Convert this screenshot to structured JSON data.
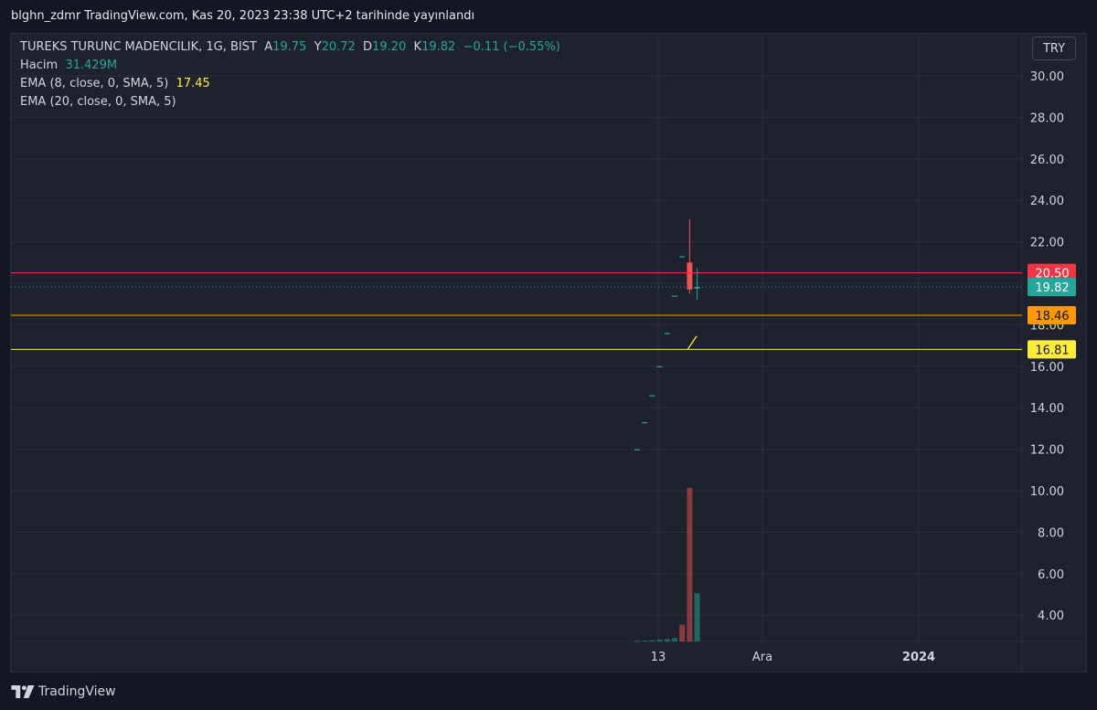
{
  "header": {
    "publish_text": "blghn_zdmr TradingView.com, Kas 20, 2023 23:38 UTC+2 tarihinde yayınlandı"
  },
  "legend": {
    "symbol": "TUREKS TURUNC MADENCILIK, 1G, BIST",
    "o_label": "A",
    "o_value": "19.75",
    "h_label": "Y",
    "h_value": "20.72",
    "l_label": "D",
    "l_value": "19.20",
    "c_label": "K",
    "c_value": "19.82",
    "change": "−0.11 (−0.55%)",
    "volume_label": "Hacim",
    "volume_value": "31.429M",
    "ema8_label": "EMA (8, close, 0, SMA, 5)",
    "ema8_value": "17.45",
    "ema20_label": "EMA (20, close, 0, SMA, 5)"
  },
  "currency_button": "TRY",
  "colors": {
    "up": "#26a69a",
    "down": "#ef5350",
    "resistance": "#f23645",
    "ema20": "#ff9800",
    "ema8": "#ffeb3b",
    "grid": "#2a2e39",
    "background": "#1e222d"
  },
  "footer": {
    "logo_icon": "tradingview-logo-icon",
    "brand": "TradingView"
  },
  "chart_data": {
    "type": "candlestick",
    "ylim": [
      3.0,
      31.0
    ],
    "y_ticks": [
      "30.00",
      "28.00",
      "26.00",
      "24.00",
      "22.00",
      "20.00",
      "18.00",
      "16.00",
      "14.00",
      "12.00",
      "10.00",
      "8.00",
      "6.00",
      "4.00"
    ],
    "x_ticks": [
      "13",
      "Ara",
      "2024"
    ],
    "candles": [
      {
        "o": 12.0,
        "h": 12.0,
        "l": 12.0,
        "c": 12.0,
        "v": 0.4
      },
      {
        "o": 13.3,
        "h": 13.3,
        "l": 13.3,
        "c": 13.3,
        "v": 0.6
      },
      {
        "o": 14.6,
        "h": 14.6,
        "l": 14.6,
        "c": 14.6,
        "v": 0.8
      },
      {
        "o": 16.0,
        "h": 16.0,
        "l": 16.0,
        "c": 16.0,
        "v": 1.2
      },
      {
        "o": 17.6,
        "h": 17.6,
        "l": 17.6,
        "c": 17.6,
        "v": 1.6
      },
      {
        "o": 19.4,
        "h": 19.4,
        "l": 19.4,
        "c": 19.4,
        "v": 2.2
      },
      {
        "o": 21.3,
        "h": 21.3,
        "l": 21.3,
        "c": 21.3,
        "v": 11
      },
      {
        "o": 21.0,
        "h": 23.1,
        "l": 19.5,
        "c": 19.7,
        "v": 100
      },
      {
        "o": 19.75,
        "h": 20.72,
        "l": 19.2,
        "c": 19.82,
        "v": 31.4
      }
    ],
    "ema8": [
      [
        16.8,
        17.45
      ]
    ],
    "levels": [
      {
        "name": "resistance",
        "value": 20.5,
        "label": "20.50"
      },
      {
        "name": "last-price",
        "value": 19.82,
        "label": "19.82"
      },
      {
        "name": "ema20",
        "value": 18.46,
        "label": "18.46"
      },
      {
        "name": "ema8",
        "value": 16.81,
        "label": "16.81"
      }
    ]
  }
}
